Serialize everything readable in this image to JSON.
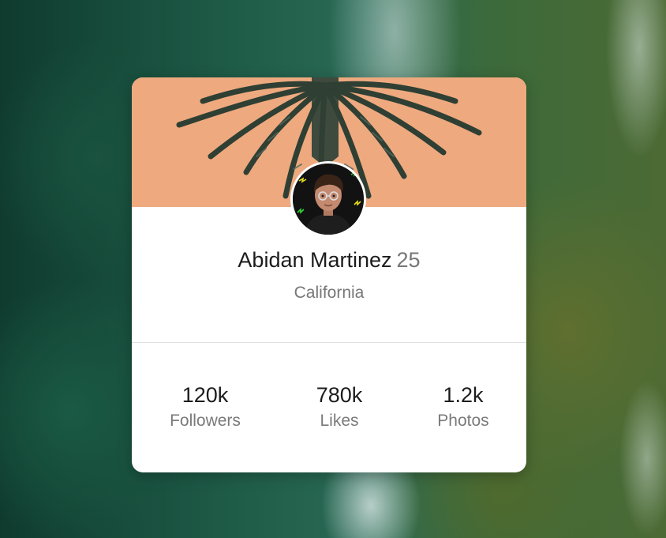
{
  "profile": {
    "name": "Abidan Martinez",
    "age": "25",
    "location": "California"
  },
  "stats": [
    {
      "value": "120k",
      "label": "Followers"
    },
    {
      "value": "780k",
      "label": "Likes"
    },
    {
      "value": "1.2k",
      "label": "Photos"
    }
  ],
  "colors": {
    "cover": "#f0ad84",
    "card": "#ffffff",
    "text": "#1c1c1c",
    "muted": "#777777"
  }
}
